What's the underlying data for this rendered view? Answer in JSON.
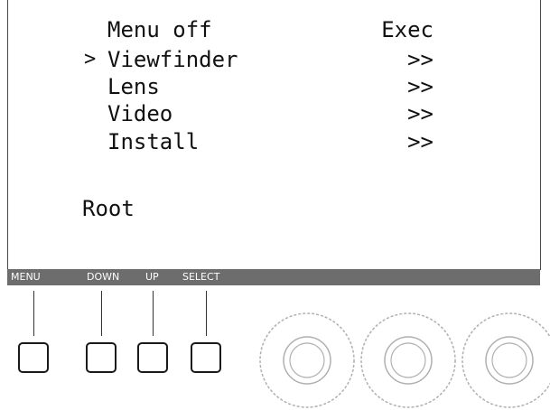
{
  "menu": {
    "items": [
      {
        "label": "Menu off",
        "value": "Exec",
        "selected": false
      },
      {
        "label": "Viewfinder",
        "value": ">>",
        "selected": true
      },
      {
        "label": "Lens",
        "value": ">>",
        "selected": false
      },
      {
        "label": "Video",
        "value": ">>",
        "selected": false
      },
      {
        "label": "Install",
        "value": ">>",
        "selected": false
      }
    ],
    "cursor_symbol": ">",
    "level_label": "Root"
  },
  "softkeys": {
    "menu": "MENU",
    "down": "DOWN",
    "up": "UP",
    "select": "SELECT"
  }
}
